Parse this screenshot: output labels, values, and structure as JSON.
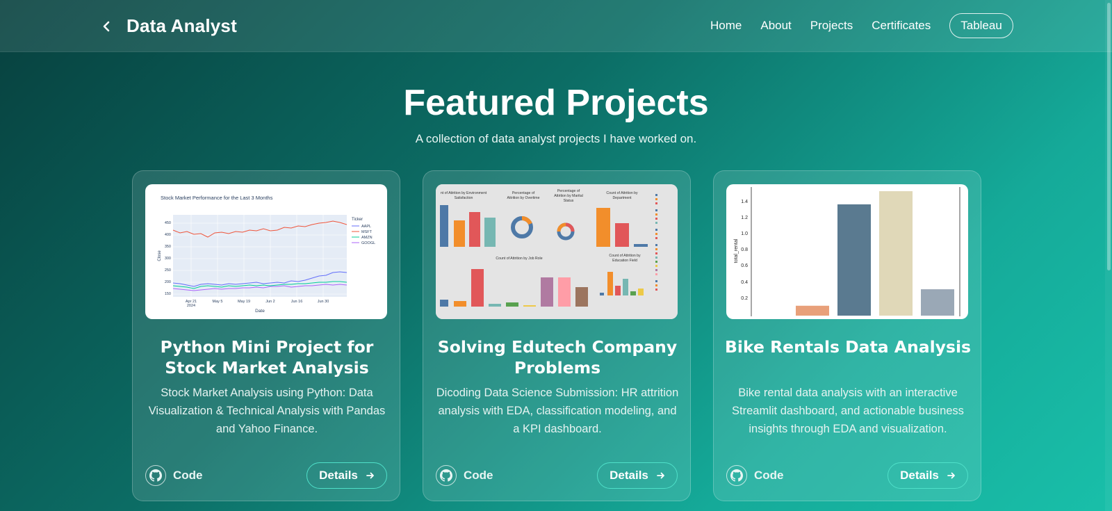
{
  "nav": {
    "back_icon": "chevron-left-icon",
    "brand": "Data Analyst",
    "links": [
      "Home",
      "About",
      "Projects",
      "Certificates"
    ],
    "cta": "Tableau"
  },
  "hero": {
    "title": "Featured Projects",
    "subtitle": "A collection of data analyst projects I have worked on."
  },
  "projects": [
    {
      "title": "Python Mini Project for Stock Market Analysis",
      "description": "Stock Market Analysis using Python: Data Visualization & Technical Analysis with Pandas and Yahoo Finance.",
      "code_label": "Code",
      "details_label": "Details",
      "thumbnail": {
        "chart_title": "Stock Market Performance for the Last 3 Months",
        "legend_title": "Ticker",
        "legend": [
          "AAPL",
          "MSFT",
          "AMZN",
          "GOOGL"
        ],
        "y_ticks": [
          "450",
          "400",
          "350",
          "300",
          "250",
          "200",
          "150"
        ],
        "x_ticks": [
          "Apr 21\n2024",
          "May 5",
          "May 19",
          "Jun 2",
          "Jun 16",
          "Jun 30"
        ],
        "xlabel": "Date",
        "ylabel": "Close"
      }
    },
    {
      "title": "Solving Edutech Company Problems",
      "description": "Dicoding Data Science Submission: HR attrition analysis with EDA, classification modeling, and a KPI dashboard.",
      "code_label": "Code",
      "details_label": "Details",
      "thumbnail": {
        "panels": [
          "Count of Attrition by Environment Satisfaction",
          "Percentage of Attrition by Overtime",
          "Percentage of Attrition by Marital Status",
          "Count of Attrition by Department",
          "Count of Attrition by Job Role",
          "Count of Attrition by Education Field"
        ]
      }
    },
    {
      "title": "Bike Rentals Data Analysis",
      "description": "Bike rental data analysis with an interactive Streamlit dashboard, and actionable business insights through EDA and visualization.",
      "code_label": "Code",
      "details_label": "Details",
      "thumbnail": {
        "ylabel": "total_rental",
        "y_ticks": [
          "1.4",
          "1.2",
          "1.0",
          "0.8",
          "0.6",
          "0.4",
          "0.2"
        ],
        "bar_values": [
          0.0,
          0.12,
          1.35,
          1.51,
          0.32
        ],
        "bar_colors": [
          "#e8a07a",
          "#e8a07a",
          "#5a7a90",
          "#e0d8b8",
          "#9aa8b6"
        ]
      }
    }
  ],
  "colors": {
    "accent": "#4fe0c9",
    "background_start": "#07403e",
    "background_end": "#19bfa9"
  }
}
